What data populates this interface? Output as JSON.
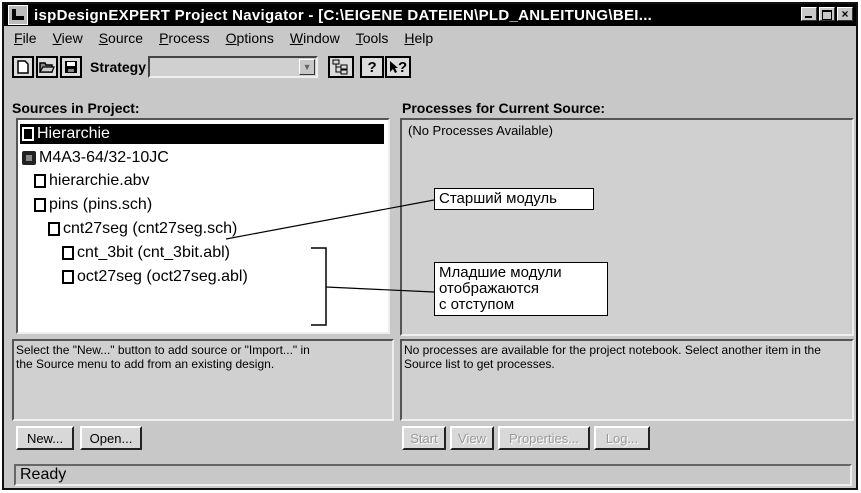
{
  "title": "ispDesignEXPERT Project Navigator - [C:\\EIGENE DATEIEN\\PLD_ANLEITUNG\\BEI...",
  "window_controls": {
    "close": "×"
  },
  "menu": [
    "File",
    "View",
    "Source",
    "Process",
    "Options",
    "Window",
    "Tools",
    "Help"
  ],
  "toolbar": {
    "strategy_label": "Strategy",
    "strategy_value": "",
    "dropdown_glyph": "▼",
    "help_glyph": "?",
    "context_help_glyph": "?"
  },
  "sources": {
    "heading": "Sources in Project:",
    "items": [
      {
        "label": "Hierarchie",
        "icon": "document-icon",
        "selected": true
      },
      {
        "label": "M4A3-64/32-10JC",
        "icon": "chip-icon",
        "selected": false
      },
      {
        "label": "hierarchie.abv",
        "icon": "abv-file-icon",
        "selected": false
      },
      {
        "label": "pins (pins.sch)",
        "icon": "schematic-file-icon",
        "selected": false
      },
      {
        "label": "cnt27seg (cnt27seg.sch)",
        "icon": "schematic-file-icon",
        "selected": false
      },
      {
        "label": "cnt_3bit (cnt_3bit.abl)",
        "icon": "abel-file-icon",
        "selected": false
      },
      {
        "label": "oct27seg (oct27seg.abl)",
        "icon": "abel-file-icon",
        "selected": false
      }
    ],
    "hint": "Select the \"New...\" button to add source or \"Import...\" in the Source menu to add from an existing design.",
    "buttons": {
      "new": "New...",
      "open": "Open..."
    }
  },
  "processes": {
    "heading": "Processes for Current Source:",
    "empty_text": "(No Processes Available)",
    "hint": "No processes are available for the project notebook.  Select another item in the Source list to get processes.",
    "buttons": {
      "start": "Start",
      "view": "View",
      "properties": "Properties...",
      "log": "Log..."
    }
  },
  "annotations": {
    "top_module": "Старший модуль",
    "sub_modules_line1": "Младшие модули",
    "sub_modules_line2": "отображаются",
    "sub_modules_line3": "с отступом"
  },
  "status": "Ready"
}
